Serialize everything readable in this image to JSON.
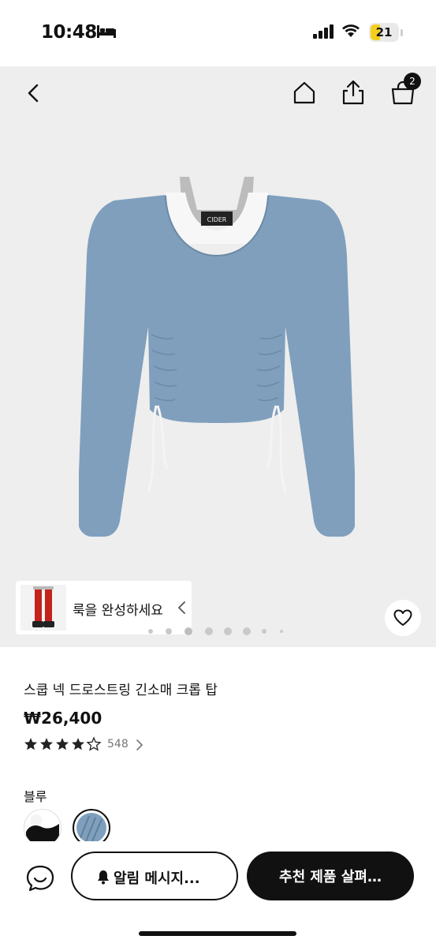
{
  "status_bar": {
    "time": "10:48",
    "battery_level": "21",
    "icons": [
      "bed-icon",
      "signal-icon",
      "wifi-icon",
      "battery-icon"
    ]
  },
  "header": {
    "cart_count": "2",
    "icons": [
      "back-arrow-icon",
      "home-icon",
      "share-icon",
      "cart-icon"
    ]
  },
  "gallery": {
    "brand_tag": "CIDER",
    "look_chip_label": "룩을 완성하세요",
    "wishlist_icon": "heart-icon"
  },
  "product": {
    "title": "스쿱 넥 드로스트링 긴소매 크롭 탑",
    "price": "₩26,400",
    "rating": 4.5,
    "review_count": "548",
    "color_label": "블루",
    "swatches": [
      "black-white-swatch",
      "blue-swatch"
    ],
    "colors": {
      "garment_blue": "#7f9fbd",
      "accent": "#111111"
    }
  },
  "actions": {
    "notify_label": "알림 메시지...",
    "recommend_label": "추천 제품 살펴…",
    "icons": [
      "chat-icon",
      "bell-icon"
    ]
  }
}
